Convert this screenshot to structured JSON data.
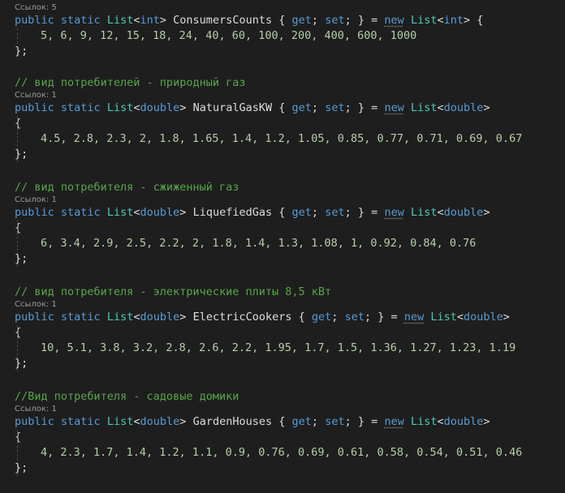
{
  "blocks": [
    {
      "comment": "",
      "refs": "Ссылок: 5",
      "elem_type": "int",
      "name": "ConsumersCounts",
      "values": "5, 6, 9, 12, 15, 18, 24, 40, 60, 100, 200, 400, 600, 1000"
    },
    {
      "comment": "// вид потребителей - природный газ",
      "refs": "Ссылок: 1",
      "elem_type": "double",
      "name": "NaturalGasKW",
      "values": "4.5, 2.8, 2.3, 2, 1.8, 1.65, 1.4, 1.2, 1.05, 0.85, 0.77, 0.71, 0.69, 0.67"
    },
    {
      "comment": "// вид потребителя - сжиженный газ",
      "refs": "Ссылок: 1",
      "elem_type": "double",
      "name": "LiquefiedGas",
      "values": "6, 3.4, 2.9, 2.5, 2.2, 2, 1.8, 1.4, 1.3, 1.08, 1, 0.92, 0.84, 0.76"
    },
    {
      "comment": "// вид потребителя - электрические плиты 8,5 кВт",
      "refs": "Ссылок: 1",
      "elem_type": "double",
      "name": "ElectricCookers",
      "values": "10, 5.1, 3.8, 3.2, 2.8, 2.6, 2.2, 1.95, 1.7, 1.5, 1.36, 1.27, 1.23, 1.19"
    },
    {
      "comment": "//Вид потребителя - садовые домики",
      "refs": "Ссылок: 1",
      "elem_type": "double",
      "name": "GardenHouses",
      "values": "4, 2.3, 1.7, 1.4, 1.2, 1.1, 0.9, 0.76, 0.69, 0.61, 0.58, 0.54, 0.51, 0.46"
    }
  ],
  "tokens": {
    "public": "public",
    "static": "static",
    "list": "List",
    "open_angle": "<",
    "close_angle": ">",
    "open_brace": "{",
    "get": "get",
    "set": "set",
    "semicolon": ";",
    "close_brace": "}",
    "equals": "=",
    "new": "new",
    "close_stmt": "};"
  },
  "colors": {
    "background": "#1e1e1e",
    "keyword": "#569cd6",
    "type": "#4ec9b0",
    "identifier": "#dcdcdc",
    "number": "#b5cea8",
    "comment": "#57a64a",
    "codelens": "#999999"
  }
}
